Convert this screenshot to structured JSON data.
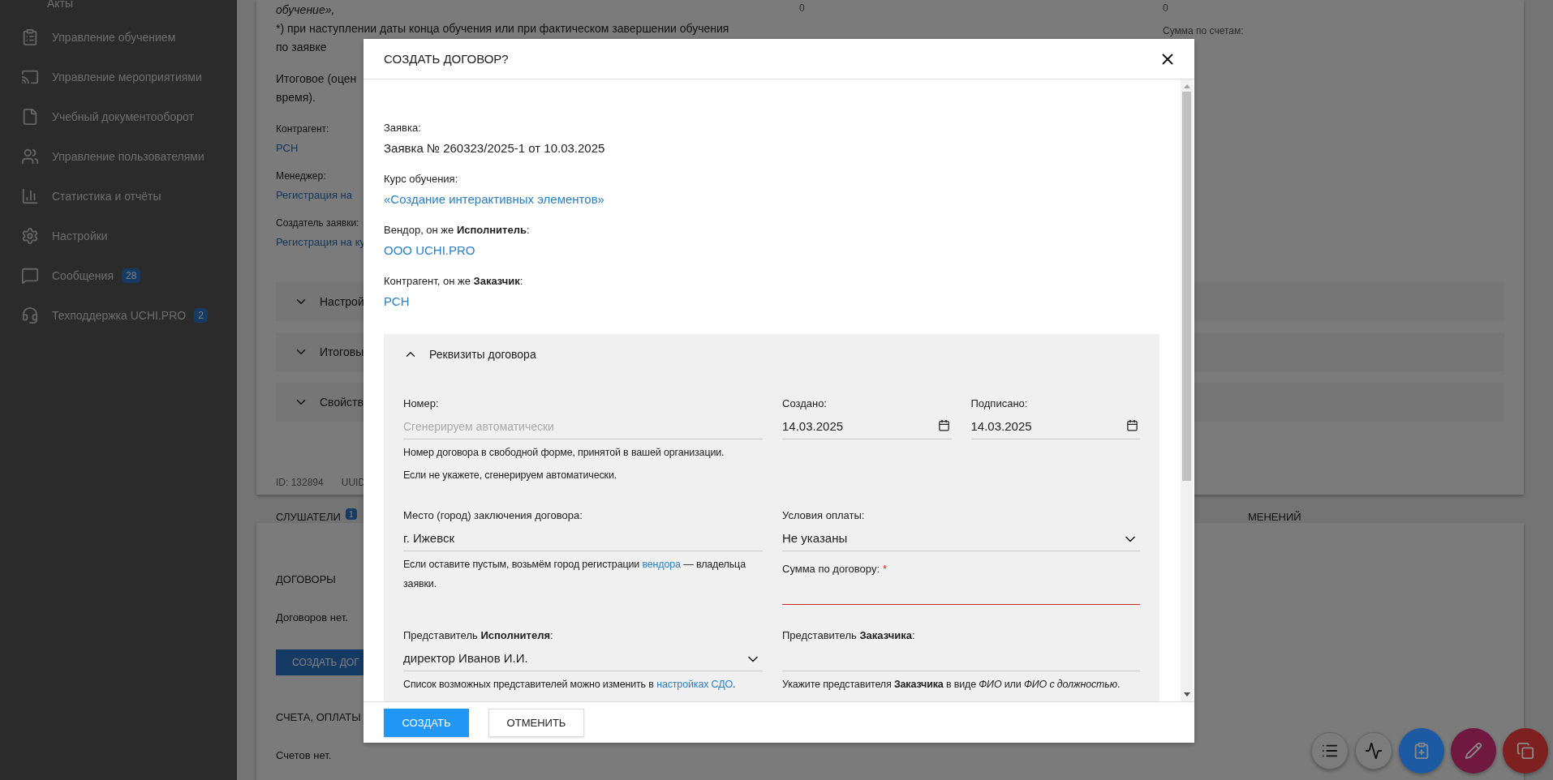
{
  "sidebar": {
    "items": [
      {
        "label": "Акты"
      },
      {
        "label": "Управление обучением"
      },
      {
        "label": "Управление мероприятиями"
      },
      {
        "label": "Учебный документооборот"
      },
      {
        "label": "Управление пользователями"
      },
      {
        "label": "Статистика и отчёты"
      },
      {
        "label": "Настройки"
      },
      {
        "label": "Сообщения",
        "badge": "28"
      },
      {
        "label": "Техподдержка UCHI.PRO",
        "badge": "2"
      }
    ]
  },
  "page": {
    "intro_lines": [
      "обучение»,",
      "*)  при наступлении даты конца обучения или при фактическом завершении обучения",
      "по заявке"
    ],
    "summary_lines": [
      "Итоговое (оцен",
      "время)."
    ],
    "details": [
      {
        "label": "Контрагент:",
        "value": "РСН"
      },
      {
        "label": "Менеджер:",
        "value": "Регистрация на"
      },
      {
        "label": "Создатель заявки:",
        "value": "Регистрация на ку"
      }
    ],
    "columns": [
      {
        "lines": [
          "0"
        ]
      },
      {
        "lines": [
          "0",
          "Сумма по счетам:"
        ]
      }
    ],
    "accordions": [
      {
        "title": "Настрой",
        "expanded": false
      },
      {
        "title": "Итоговы",
        "expanded": false
      },
      {
        "title": "Свойств",
        "expanded": false
      }
    ],
    "meta": [
      "ID:  132894",
      "UUID"
    ],
    "tabs": [
      {
        "label": "СЛУШАТЕЛИ",
        "badge": "1"
      },
      {
        "label": "МЕНЕНИЙ"
      }
    ],
    "contracts": {
      "title": "ДОГОВОРЫ",
      "empty": "Договоров нет.",
      "button": "СОЗДАТЬ ДОГ"
    },
    "invoices": {
      "title": "СЧЕТА, ОПЛАТЫ",
      "empty": "Счетов нет."
    },
    "fabs": [
      {
        "color": "#7c7c7c"
      },
      {
        "color": "#7c7c7c"
      },
      {
        "color": "#1c5aa3"
      },
      {
        "color": "#711840"
      },
      {
        "color": "#7e2020"
      }
    ]
  },
  "dialog": {
    "title": "СОЗДАТЬ ДОГОВОР?",
    "info": [
      {
        "label": "Заявка:",
        "value": "Заявка № 260323/2025-1 от 10.03.2025",
        "kind": "text"
      },
      {
        "label": "Курс обучения:",
        "value": "«Создание интерактивных элементов»",
        "kind": "link"
      },
      {
        "label": "Вендор, он же **Исполнитель**:",
        "value": "ООО UCHI.PRO",
        "kind": "link"
      },
      {
        "label": "Контрагент, он же **Заказчик**:",
        "value": "РСН",
        "kind": "link"
      }
    ],
    "section": {
      "title": "Реквизиты договора",
      "expanded": true,
      "rows": [
        {
          "left": {
            "kind": "text",
            "label": "Номер:",
            "placeholder": "Сгенерируем автоматически",
            "hint": [
              [
                {
                  "text": "Номер договора в свободной форме, принятой в вашей организации."
                }
              ],
              [
                {
                  "text": "Если не укажете, сгенерируем автоматически."
                }
              ]
            ]
          },
          "right": [
            [
              {
                "kind": "date",
                "label": "Создано:",
                "value": "14.03.2025"
              },
              {
                "kind": "date",
                "label": "Подписано:",
                "value": "14.03.2025"
              }
            ]
          ]
        },
        {
          "left": {
            "kind": "text",
            "label": "Место (город) заключения договора:",
            "value": "г. Ижевск",
            "hint": [
              [
                {
                  "text": "Если оставите пустым, возьмём город регистрации "
                },
                {
                  "text": "вендора",
                  "link": true
                },
                {
                  "text": " — владельца заявки."
                }
              ]
            ]
          },
          "right": [
            [
              {
                "kind": "select",
                "label": "Условия оплаты:",
                "value": "Не указаны"
              }
            ],
            [
              {
                "kind": "text",
                "label": "Сумма по договору:",
                "required_mark": "*",
                "invalid": true
              }
            ]
          ]
        },
        {
          "left": {
            "kind": "select",
            "label": "Представитель **Исполнителя**:",
            "value": "директор Иванов И.И.",
            "hint": [
              [
                {
                  "text": "Список возможных представителей можно изменить в "
                },
                {
                  "text": "настройках СДО",
                  "link": true
                },
                {
                  "text": "."
                }
              ]
            ]
          },
          "right": [
            [
              {
                "kind": "text",
                "label": "Представитель **Заказчика**:",
                "hint": [
                  [
                    {
                      "text": "Укажите представителя **Заказчика** в виде *ФИО* или *ФИО с должностью*."
                    }
                  ]
                ]
              }
            ]
          ]
        }
      ]
    },
    "buttons": [
      {
        "label": "СОЗДАТЬ",
        "kind": "primary"
      },
      {
        "label": "ОТМЕНИТЬ",
        "kind": "secondary"
      }
    ]
  }
}
